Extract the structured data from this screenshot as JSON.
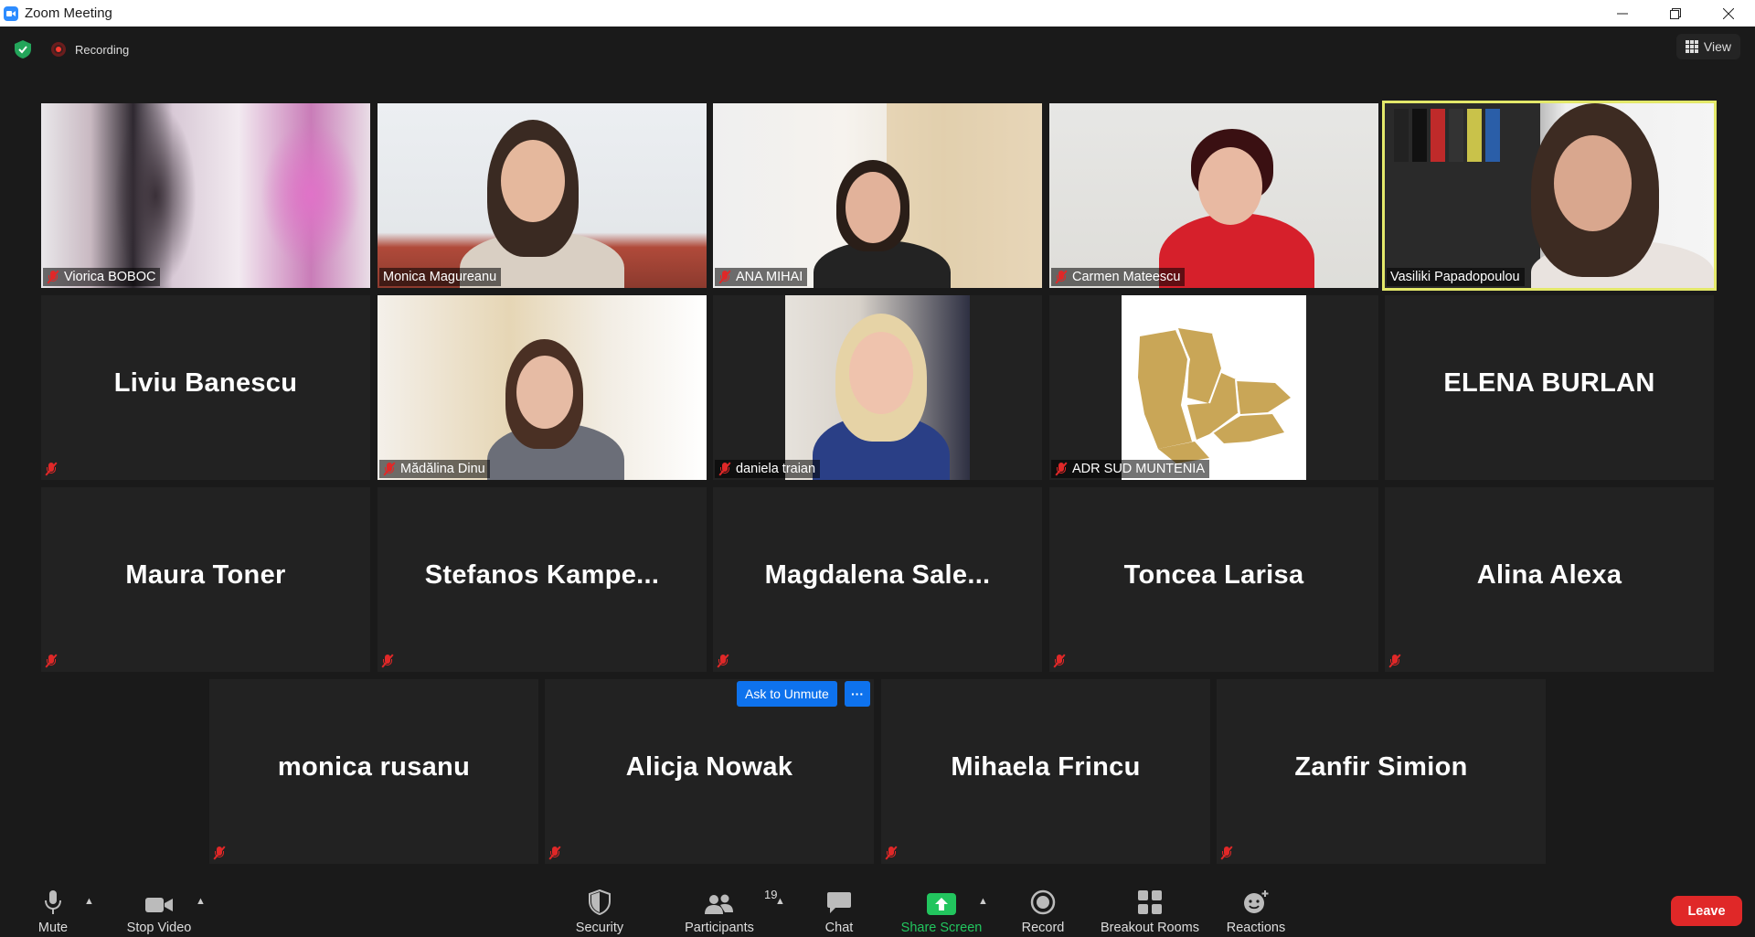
{
  "window": {
    "title": "Zoom Meeting",
    "controls": [
      "minimize",
      "maximize",
      "close"
    ]
  },
  "meeting_bar": {
    "recording_label": "Recording",
    "view_label": "View"
  },
  "participants": [
    {
      "name": "Viorica BOBOC",
      "video": true,
      "muted": true
    },
    {
      "name": "Monica Magureanu",
      "video": true,
      "muted": false
    },
    {
      "name": "ANA MIHAI",
      "video": true,
      "muted": true
    },
    {
      "name": "Carmen Mateescu",
      "video": true,
      "muted": true
    },
    {
      "name": "Vasiliki Papadopoulou",
      "video": true,
      "muted": false,
      "active_speaker": true
    },
    {
      "name": "Liviu Banescu",
      "video": false,
      "muted": true
    },
    {
      "name": "Mădălina Dinu",
      "video": true,
      "muted": true
    },
    {
      "name": "daniela traian",
      "video": true,
      "muted": true
    },
    {
      "name": "ADR SUD MUNTENIA",
      "video": true,
      "muted": true
    },
    {
      "name": "ELENA BURLAN",
      "video": false,
      "muted": false
    },
    {
      "name": "Maura Toner",
      "video": false,
      "muted": true
    },
    {
      "name": "Stefanos  Kampe...",
      "video": false,
      "muted": true
    },
    {
      "name": "Magdalena  Sale...",
      "video": false,
      "muted": true
    },
    {
      "name": "Toncea Larisa",
      "video": false,
      "muted": true
    },
    {
      "name": "Alina Alexa",
      "video": false,
      "muted": true
    },
    {
      "name": "monica rusanu",
      "video": false,
      "muted": true
    },
    {
      "name": "Alicja Nowak",
      "video": false,
      "muted": true
    },
    {
      "name": "Mihaela Frincu",
      "video": false,
      "muted": true
    },
    {
      "name": "Zanfir Simion",
      "video": false,
      "muted": true
    }
  ],
  "tile_overlay": {
    "ask_to_unmute": "Ask to Unmute",
    "more": "···"
  },
  "toolbar": {
    "mute": "Mute",
    "stop_video": "Stop Video",
    "security": "Security",
    "participants": "Participants",
    "participants_count": "19",
    "chat": "Chat",
    "share_screen": "Share Screen",
    "record": "Record",
    "breakout_rooms": "Breakout Rooms",
    "reactions": "Reactions",
    "leave": "Leave"
  },
  "colors": {
    "background": "#1a1a1a",
    "tile": "#222222",
    "active_speaker_border": "#e3e86a",
    "accent_blue": "#0e72ed",
    "share_green": "#22c55e",
    "leave_red": "#e02828",
    "muted_red": "#e02828"
  }
}
